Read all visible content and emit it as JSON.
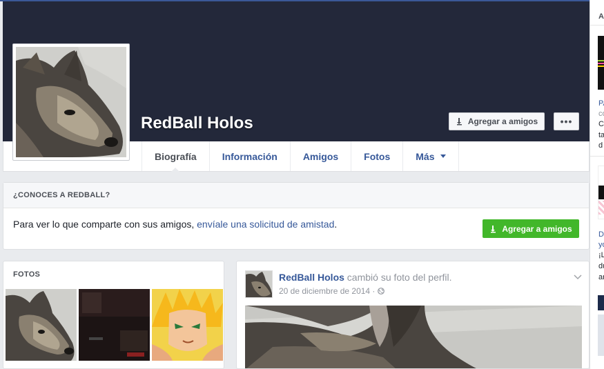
{
  "profile": {
    "name": "RedBall Holos",
    "add_friend_label": "Agregar a amigos",
    "more_label": "•••"
  },
  "nav": {
    "tabs": [
      {
        "label": "Biografía",
        "active": true
      },
      {
        "label": "Información"
      },
      {
        "label": "Amigos"
      },
      {
        "label": "Fotos"
      },
      {
        "label": "Más"
      }
    ]
  },
  "know_box": {
    "title": "¿CONOCES A REDBALL?",
    "text_prefix": "Para ver lo que comparte con sus amigos,",
    "link_text": "envíale una solicitud de amistad",
    "text_suffix": ".",
    "button_label": "Agregar a amigos"
  },
  "photos_box": {
    "title": "FOTOS"
  },
  "post": {
    "author": "RedBall Holos",
    "action": "cambió su foto del perfil.",
    "date": "20 de diciembre de 2014 ·"
  },
  "sidebar_fragments": {
    "a": "A",
    "pa": "PA",
    "co": "co",
    "c": "C",
    "ta": "ta",
    "d1": "d",
    "d2": "D",
    "yo": "yo",
    "l": "¡L",
    "du": "du",
    "ar": "ar"
  },
  "colors": {
    "cover": "#23283a",
    "link": "#365899",
    "green_button": "#42b72a",
    "page_bg": "#e9ebee"
  }
}
